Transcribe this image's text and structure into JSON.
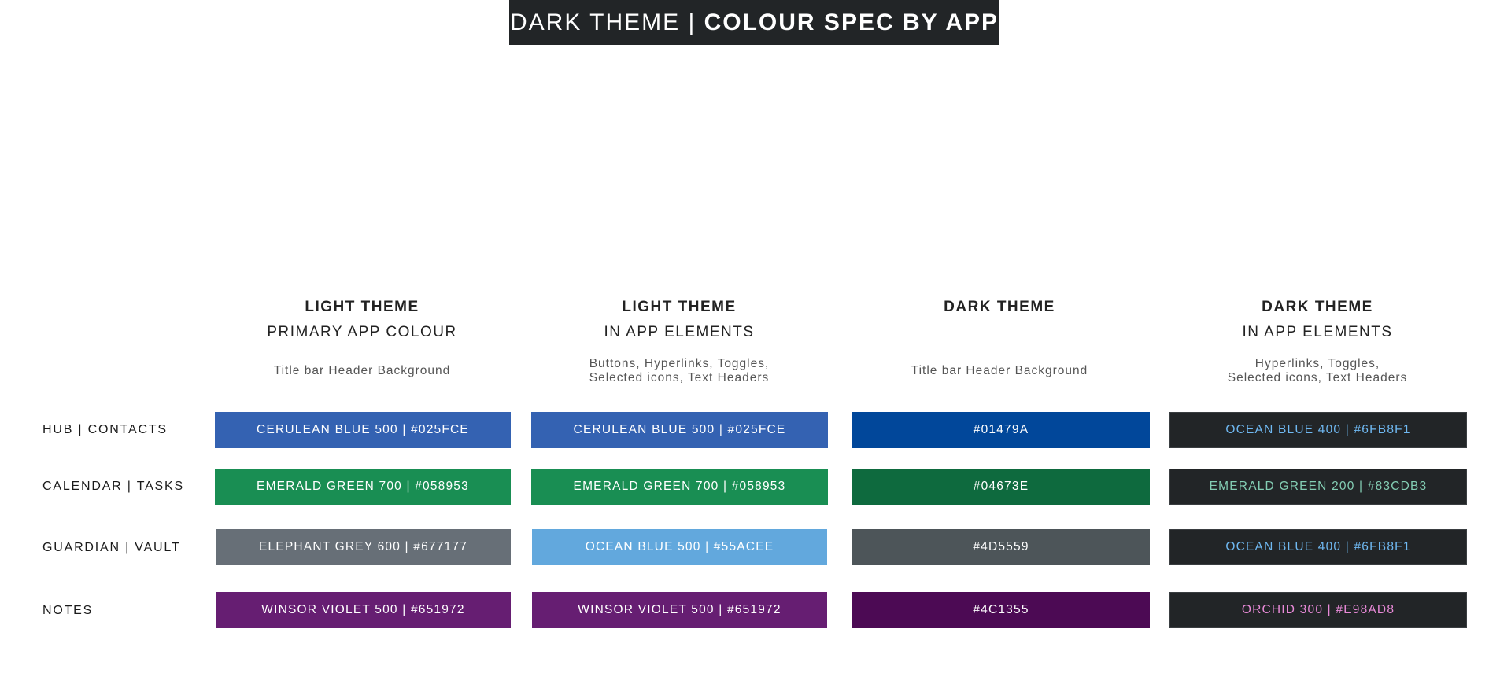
{
  "banner": {
    "prefix": "DARK THEME | ",
    "title": "COLOUR SPEC BY APP"
  },
  "columns": [
    {
      "line1": "LIGHT THEME",
      "line2": "PRIMARY APP COLOUR",
      "desc1": "Title bar Header Background",
      "desc2": ""
    },
    {
      "line1": "LIGHT THEME",
      "line2": "IN APP ELEMENTS",
      "desc1": "Buttons, Hyperlinks, Toggles,",
      "desc2": "Selected icons, Text Headers"
    },
    {
      "line1": "DARK THEME",
      "line2": "",
      "desc1": "Title bar Header Background",
      "desc2": ""
    },
    {
      "line1": "DARK THEME",
      "line2": "IN APP ELEMENTS",
      "desc1": "Hyperlinks, Toggles,",
      "desc2": "Selected icons, Text Headers"
    }
  ],
  "rows": [
    {
      "label": "HUB | CONTACTS",
      "swatches": [
        {
          "text": "CERULEAN BLUE 500 | #025FCE",
          "bg": "#3462B2",
          "fg": "#FFFFFF"
        },
        {
          "text": "CERULEAN BLUE 500 | #025FCE",
          "bg": "#3462B2",
          "fg": "#FFFFFF"
        },
        {
          "text": "#01479A",
          "bg": "#01479A",
          "fg": "#FFFFFF"
        },
        {
          "text": "OCEAN BLUE 400 | #6FB8F1",
          "bg": "#222527",
          "fg": "#6FB8F1"
        }
      ]
    },
    {
      "label": "CALENDAR | TASKS",
      "swatches": [
        {
          "text": "EMERALD GREEN 700 | #058953",
          "bg": "#198E53",
          "fg": "#FFFFFF"
        },
        {
          "text": "EMERALD GREEN 700 | #058953",
          "bg": "#198E53",
          "fg": "#FFFFFF"
        },
        {
          "text": "#04673E",
          "bg": "#0E6A3E",
          "fg": "#FFFFFF"
        },
        {
          "text": "EMERALD GREEN 200 | #83CDB3",
          "bg": "#222527",
          "fg": "#83CDB3"
        }
      ]
    },
    {
      "label": "GUARDIAN | VAULT",
      "swatches": [
        {
          "text": "ELEPHANT GREY 600 | #677177",
          "bg": "#676F77",
          "fg": "#FFFFFF"
        },
        {
          "text": "OCEAN BLUE 500 | #55ACEE",
          "bg": "#62A8DD",
          "fg": "#FFFFFF"
        },
        {
          "text": "#4D5559",
          "bg": "#4D5559",
          "fg": "#FFFFFF"
        },
        {
          "text": "OCEAN BLUE 400 | #6FB8F1",
          "bg": "#222527",
          "fg": "#6FB8F1"
        }
      ]
    },
    {
      "label": "NOTES",
      "swatches": [
        {
          "text": "WINSOR VIOLET 500 | #651972",
          "bg": "#661E72",
          "fg": "#FFFFFF"
        },
        {
          "text": "WINSOR VIOLET 500 | #651972",
          "bg": "#661E72",
          "fg": "#FFFFFF"
        },
        {
          "text": "#4C1355",
          "bg": "#4C0A54",
          "fg": "#FFFFFF"
        },
        {
          "text": "ORCHID 300 | #E98AD8",
          "bg": "#222527",
          "fg": "#E98AD8"
        }
      ]
    }
  ]
}
